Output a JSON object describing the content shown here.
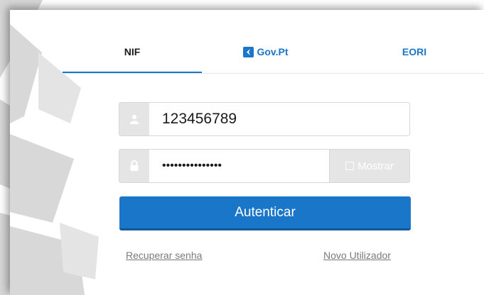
{
  "tabs": [
    {
      "label": "NIF",
      "active": true
    },
    {
      "label": "Gov.Pt",
      "active": false,
      "icon": "govpt-logo-icon"
    },
    {
      "label": "EORI",
      "active": false
    }
  ],
  "form": {
    "username_value": "123456789",
    "username_icon": "user-icon",
    "password_mask": "•••••••••••••••",
    "password_icon": "lock-icon",
    "show_password_label": "Mostrar",
    "submit_label": "Autenticar"
  },
  "links": {
    "recover": "Recuperar senha",
    "new_user": "Novo Utilizador"
  },
  "colors": {
    "accent": "#1a76c8",
    "addon_bg": "#e5e5e5",
    "background_art": "#d4d4d4"
  }
}
